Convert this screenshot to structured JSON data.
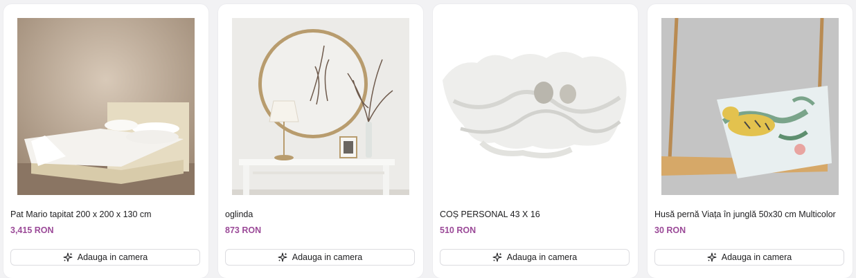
{
  "products": [
    {
      "name": "Pat Mario tapitat 200 x 200 x 130 cm",
      "price": "3,415 RON",
      "image": "bed"
    },
    {
      "name": "oglinda",
      "price": "873 RON",
      "image": "mirror"
    },
    {
      "name": "COȘ PERSONAL 43 X 16",
      "price": "510 RON",
      "image": "shell-bowl"
    },
    {
      "name": "Husă pernă Viața în junglă 50x30 cm Multicolor",
      "price": "30 RON",
      "image": "swing-pillow"
    }
  ],
  "add_button": {
    "label": "Adauga in camera",
    "icon": "sparkles-icon"
  },
  "colors": {
    "price": "#9b4a98",
    "card_bg": "#ffffff",
    "page_bg": "#f2f2f4"
  }
}
